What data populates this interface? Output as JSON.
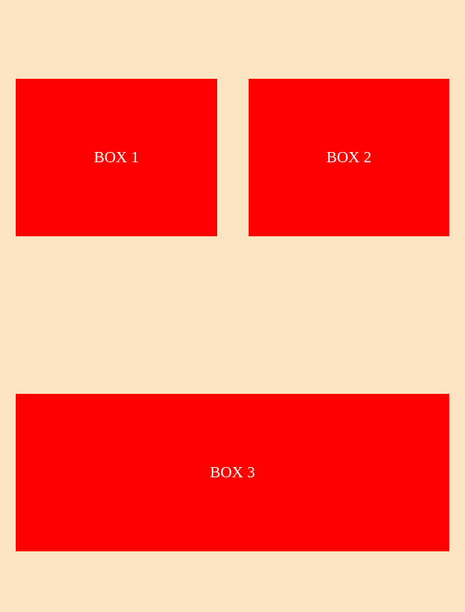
{
  "colors": {
    "background": "#fde4c3",
    "box_fill": "#ff0000",
    "box_text": "#ffffff"
  },
  "boxes": [
    {
      "label": "BOX 1"
    },
    {
      "label": "BOX 2"
    },
    {
      "label": "BOX 3"
    }
  ]
}
